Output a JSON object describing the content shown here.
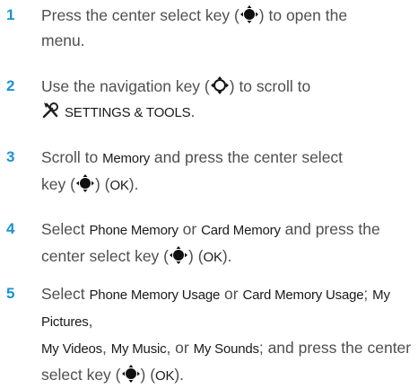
{
  "steps": [
    {
      "number": "1",
      "parts": [
        "Press the center select key (",
        ") to open the",
        "menu."
      ]
    },
    {
      "number": "2",
      "parts": [
        "Use the navigation key (",
        ") to scroll to",
        "SETTINGS & TOOLS",
        "."
      ]
    },
    {
      "number": "3",
      "parts": [
        "Scroll to ",
        "Memory",
        " and press the center select",
        "key (",
        ") (",
        "OK",
        ")."
      ]
    },
    {
      "number": "4",
      "parts": [
        "Select ",
        "Phone Memory",
        " or ",
        "Card Memory",
        " and press the",
        "center select key (",
        ") (",
        "OK",
        ")."
      ]
    },
    {
      "number": "5",
      "parts": [
        "Select ",
        "Phone Memory Usage",
        " or ",
        "Card Memory Usage",
        "; ",
        "My Pictures",
        ",",
        "My Videos",
        ", ",
        "My Music",
        ", or ",
        "My Sounds",
        "; and press the center",
        "select key (",
        ") (",
        "OK",
        ")."
      ]
    }
  ],
  "icons": {
    "center_select": "center-select-key-icon",
    "nav_key": "navigation-key-icon",
    "settings_tools": "settings-tools-icon"
  },
  "colors": {
    "step_number": "#1a93d4",
    "body_text": "#4f4f4f",
    "keyword": "#1a1a1a"
  }
}
